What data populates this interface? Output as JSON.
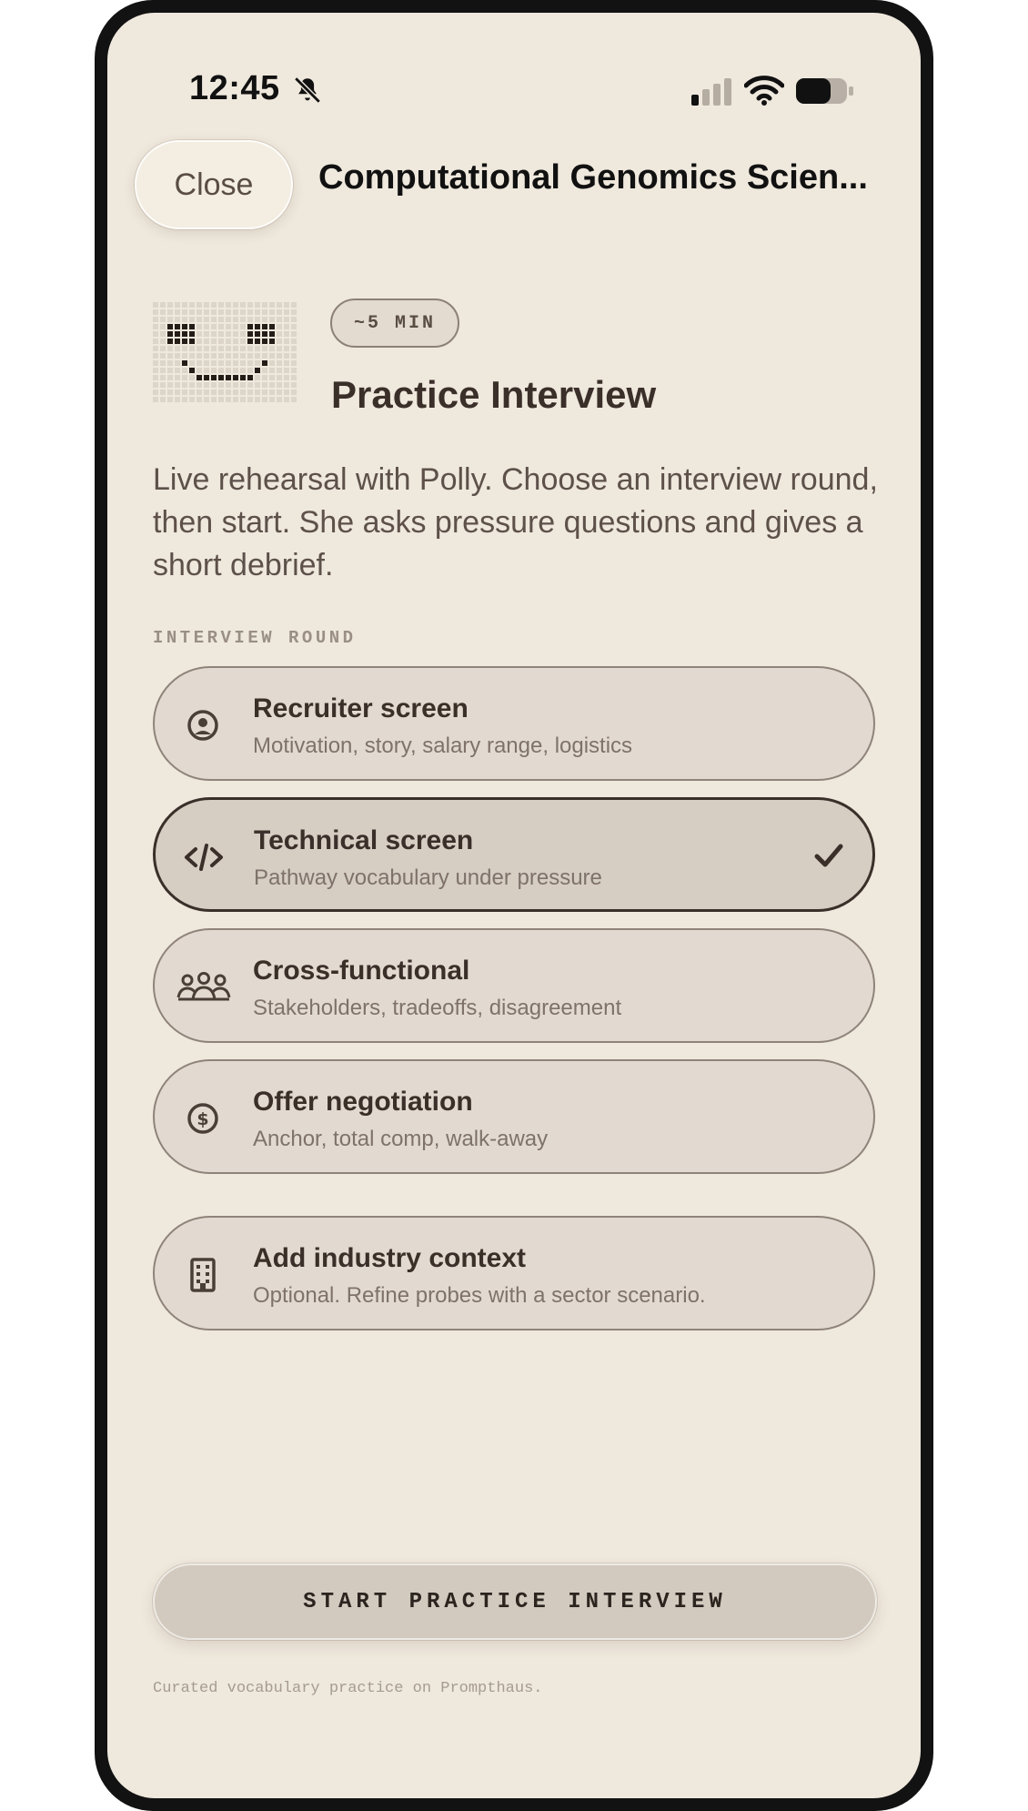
{
  "status_bar": {
    "time": "12:45",
    "icons": [
      "bell-slash-icon",
      "cellular-signal-icon",
      "wifi-icon",
      "battery-icon"
    ]
  },
  "header": {
    "close_label": "Close",
    "title": "Computational Genomics Scien..."
  },
  "intro": {
    "avatar_icon": "pixel-smiley-icon",
    "duration": "~5 MIN",
    "title": "Practice Interview",
    "description": "Live rehearsal with Polly. Choose an interview round, then start. She asks pressure questions and gives a short debrief."
  },
  "rounds": {
    "label": "INTERVIEW ROUND",
    "items": [
      {
        "icon": "user-circle-icon",
        "title": "Recruiter screen",
        "subtitle": "Motivation, story, salary range, logistics",
        "selected": false
      },
      {
        "icon": "code-icon",
        "title": "Technical screen",
        "subtitle": "Pathway vocabulary under pressure",
        "selected": true
      },
      {
        "icon": "group-icon",
        "title": "Cross-functional",
        "subtitle": "Stakeholders, tradeoffs, disagreement",
        "selected": false
      },
      {
        "icon": "dollar-circle-icon",
        "title": "Offer negotiation",
        "subtitle": "Anchor, total comp, walk-away",
        "selected": false
      }
    ]
  },
  "industry": {
    "icon": "building-icon",
    "title": "Add industry context",
    "subtitle": "Optional. Refine probes with a sector scenario."
  },
  "start_label": "START PRACTICE INTERVIEW",
  "footer": "Curated vocabulary practice on Prompthaus.",
  "colors": {
    "background": "#efe8dd",
    "card": "#e2dad0",
    "selected_card": "#d6cdc3",
    "text_dark": "#3a2f29",
    "text_muted": "#7e726a"
  }
}
